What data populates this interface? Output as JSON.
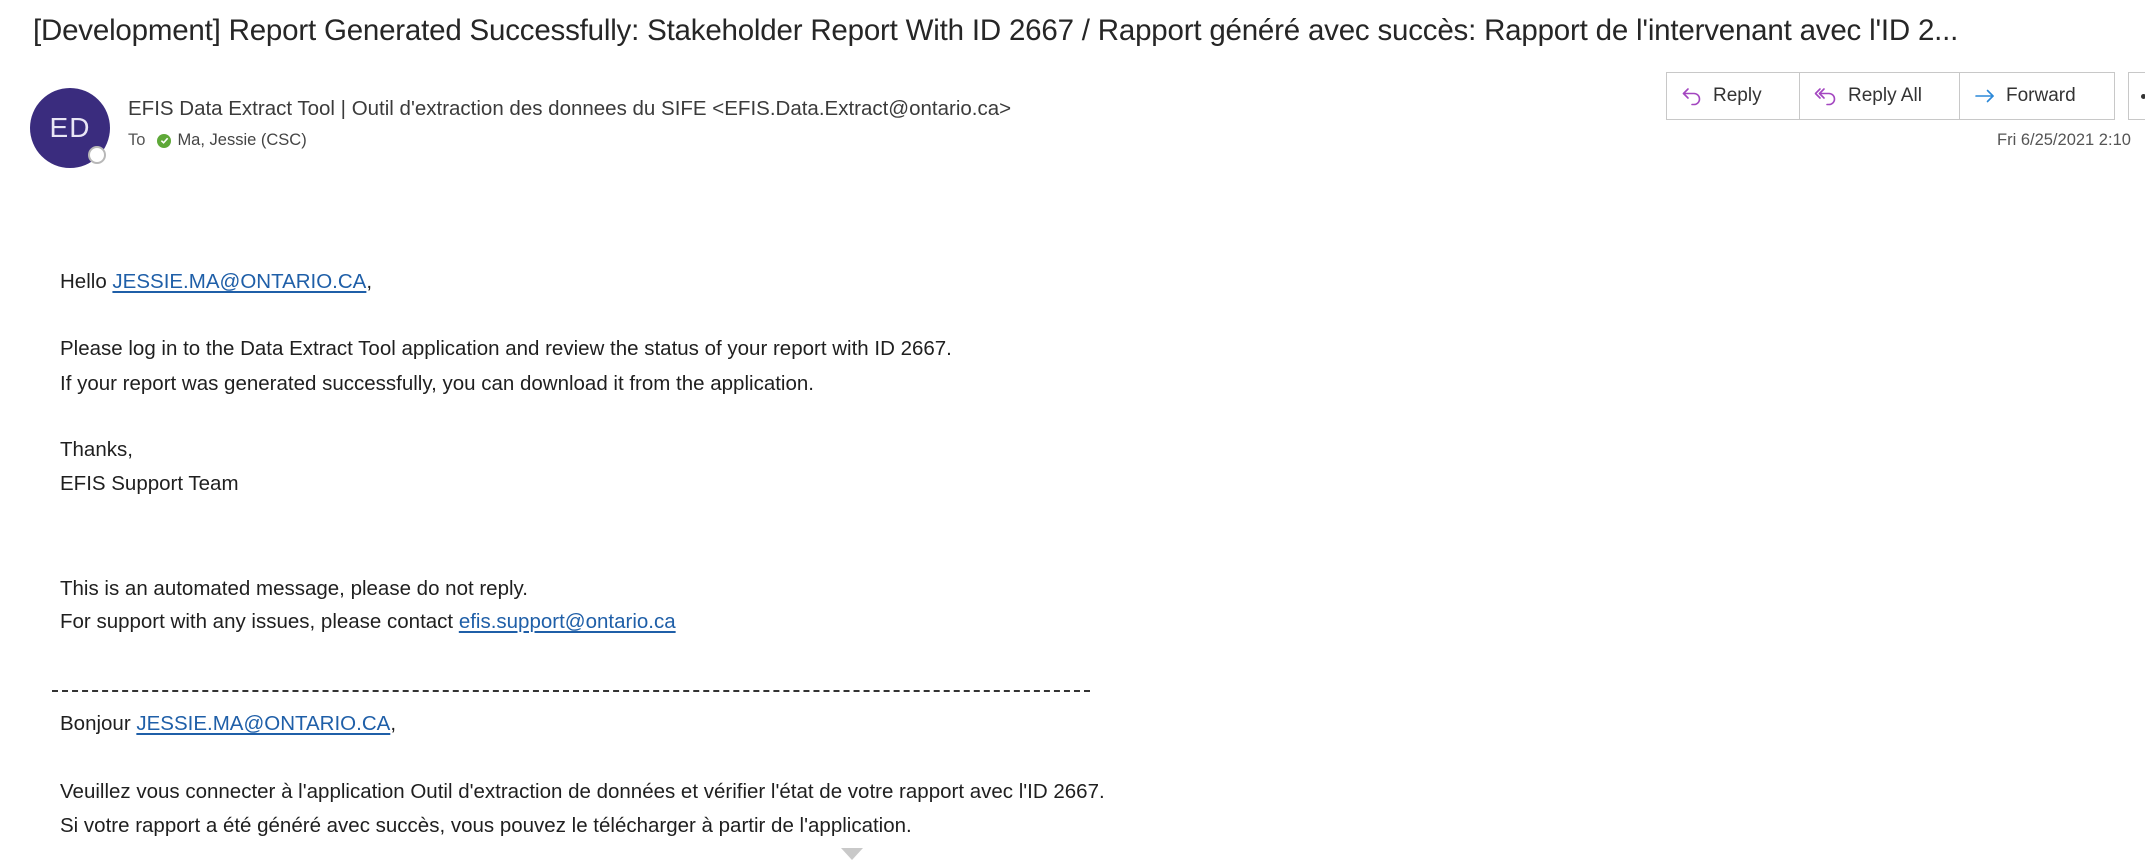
{
  "email": {
    "subject": "[Development] Report Generated Successfully: Stakeholder Report With ID 2667 / Rapport généré avec succès: Rapport de l'intervenant avec l'ID 2...",
    "sender": {
      "initials": "ED",
      "display": "EFIS Data Extract Tool | Outil d'extraction des donnees du SIFE <EFIS.Data.Extract@ontario.ca>"
    },
    "to_label": "To",
    "recipient": "Ma, Jessie (CSC)",
    "date": "Fri 6/25/2021 2:10",
    "actions": {
      "reply": "Reply",
      "reply_all": "Reply All",
      "forward": "Forward"
    },
    "colors": {
      "avatar": "#3a2c7e",
      "link": "#1f5fa8",
      "reply_icon": "#a346c0",
      "forward_icon": "#2b88d8",
      "presence_available": "#5ea838"
    }
  },
  "body": {
    "english": {
      "greeting": "Hello ",
      "greeting_email": "JESSIE.MA@ONTARIO.CA",
      "greeting_suffix": ",",
      "line1": "Please log in to the Data Extract Tool application and review the status of your report with ID 2667.",
      "line2": "If your report was generated successfully, you can download it from the application.",
      "thanks": "Thanks,",
      "signature": "EFIS Support Team",
      "automated": "This is an automated message, please do not reply.",
      "support_prefix": "For support with any issues, please contact ",
      "support_email": "efis.support@ontario.ca"
    },
    "french": {
      "greeting": "Bonjour ",
      "greeting_email": "JESSIE.MA@ONTARIO.CA",
      "greeting_suffix": ",",
      "line1": "Veuillez vous connecter à l'application Outil d'extraction de données et vérifier l'état de votre rapport avec l'ID 2667.",
      "line2": "Si votre rapport a été généré avec succès, vous pouvez le télécharger à partir de l'application."
    }
  }
}
